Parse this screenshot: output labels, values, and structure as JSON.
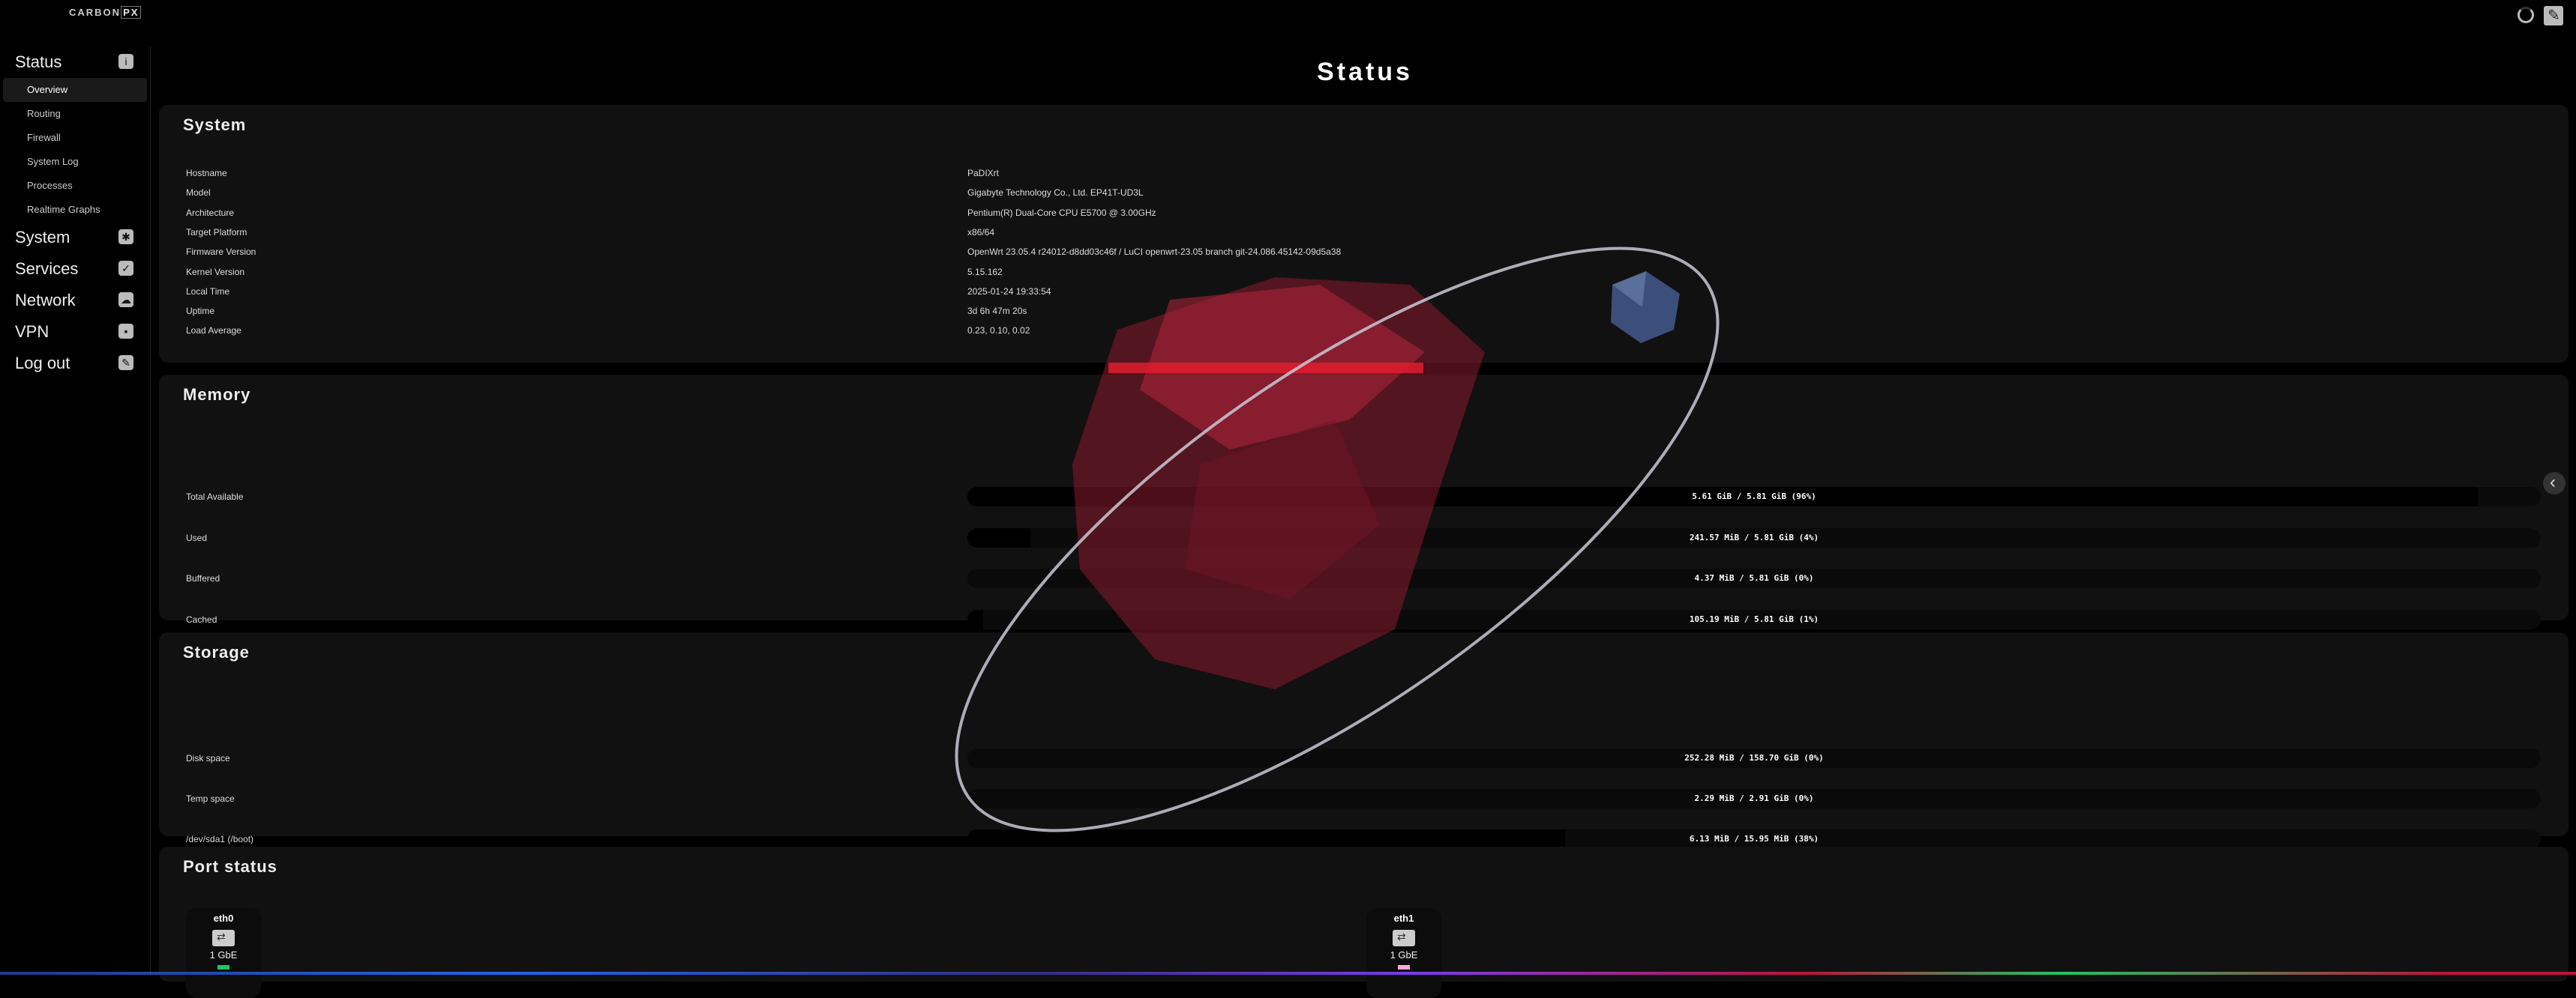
{
  "header": {
    "logo_main": "CARBON",
    "logo_accent": "PX"
  },
  "sidebar": {
    "status": {
      "label": "Status",
      "items": [
        "Overview",
        "Routing",
        "Firewall",
        "System Log",
        "Processes",
        "Realtime Graphs"
      ]
    },
    "groups": [
      "System",
      "Services",
      "Network",
      "VPN",
      "Log out"
    ]
  },
  "page": {
    "title": "Status"
  },
  "system": {
    "title": "System",
    "rows": [
      {
        "k": "Hostname",
        "v": "PaDIXrt"
      },
      {
        "k": "Model",
        "v": "Gigabyte Technology Co., Ltd. EP41T-UD3L"
      },
      {
        "k": "Architecture",
        "v": "Pentium(R) Dual-Core CPU E5700 @ 3.00GHz"
      },
      {
        "k": "Target Platform",
        "v": "x86/64"
      },
      {
        "k": "Firmware Version",
        "v": "OpenWrt 23.05.4 r24012-d8dd03c46f / LuCI openwrt-23.05 branch git-24.086.45142-09d5a38"
      },
      {
        "k": "Kernel Version",
        "v": "5.15.162"
      },
      {
        "k": "Local Time",
        "v": "2025-01-24 19:33:54"
      },
      {
        "k": "Uptime",
        "v": "3d 6h 47m 20s"
      },
      {
        "k": "Load Average",
        "v": "0.23, 0.10, 0.02"
      }
    ]
  },
  "memory": {
    "title": "Memory",
    "rows": [
      {
        "k": "Total Available",
        "v": "5.61 GiB / 5.81 GiB (96%)",
        "pct": 96
      },
      {
        "k": "Used",
        "v": "241.57 MiB / 5.81 GiB (4%)",
        "pct": 4
      },
      {
        "k": "Buffered",
        "v": "4.37 MiB / 5.81 GiB (0%)",
        "pct": 0
      },
      {
        "k": "Cached",
        "v": "105.19 MiB / 5.81 GiB (1%)",
        "pct": 1
      }
    ]
  },
  "storage": {
    "title": "Storage",
    "rows": [
      {
        "k": "Disk space",
        "v": "252.28 MiB / 158.70 GiB (0%)",
        "pct": 0
      },
      {
        "k": "Temp space",
        "v": "2.29 MiB / 2.91 GiB (0%)",
        "pct": 0
      },
      {
        "k": "/dev/sda1 (/boot)",
        "v": "6.13 MiB / 15.95 MiB (38%)",
        "pct": 38
      }
    ]
  },
  "ports": {
    "title": "Port status",
    "items": [
      {
        "name": "eth0",
        "speed": "1 GbE",
        "led": "#22c55e"
      },
      {
        "name": "eth1",
        "speed": "1 GbE",
        "led": "#f9a8d4"
      }
    ]
  },
  "colors": {
    "background": "#000000",
    "card": "#111111",
    "accent_red": "#e11d2e"
  }
}
